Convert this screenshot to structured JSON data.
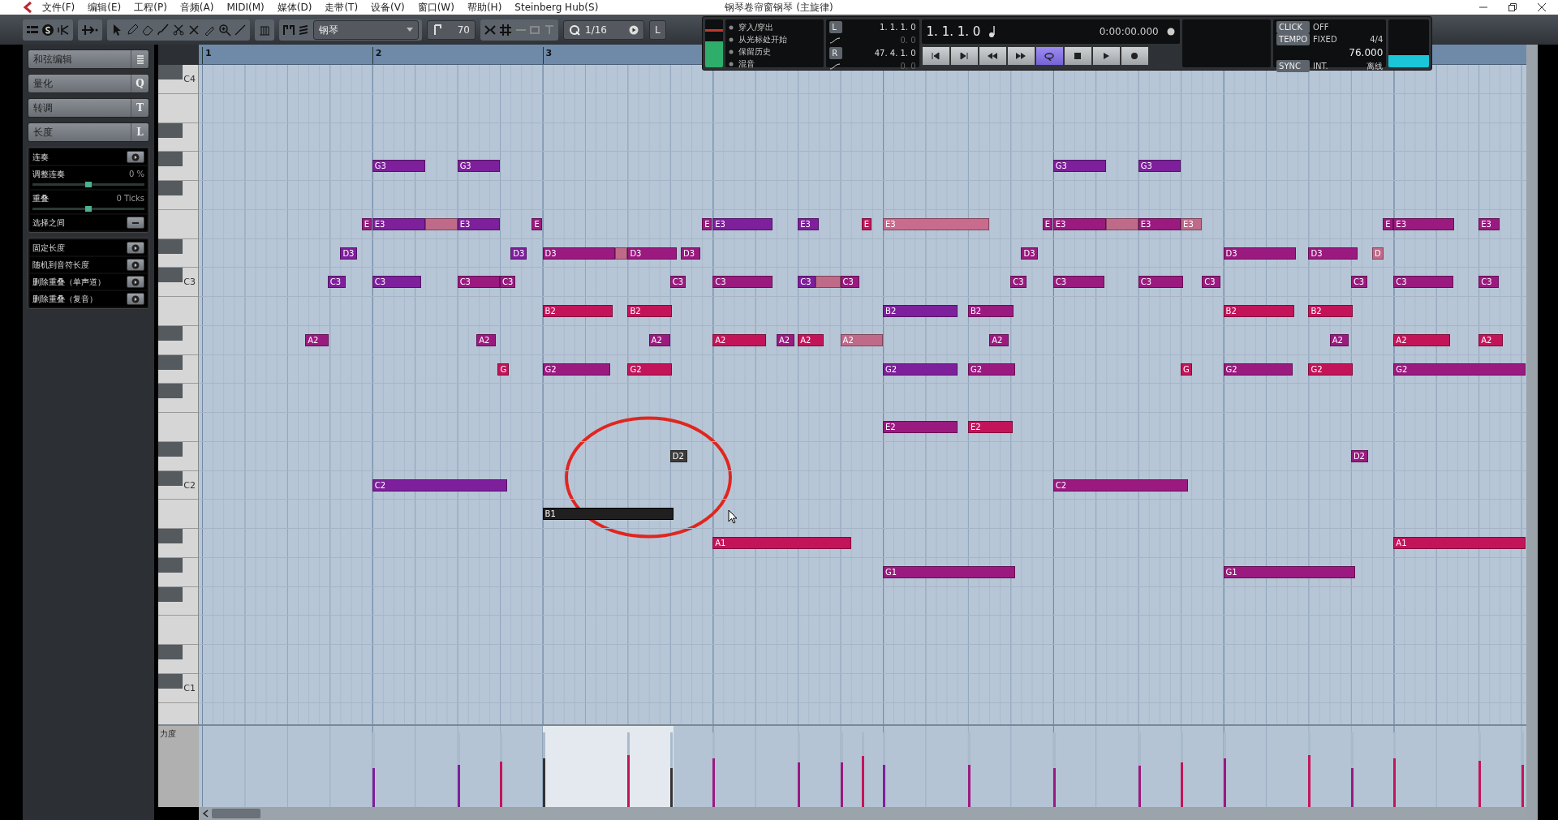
{
  "window": {
    "title": "钢琴卷帘窗钢琴 (主旋律)"
  },
  "menu": [
    "文件(F)",
    "编辑(E)",
    "工程(P)",
    "音频(A)",
    "MIDI(M)",
    "媒体(D)",
    "走带(T)",
    "设备(V)",
    "窗口(W)",
    "帮助(H)",
    "Steinberg Hub(S)"
  ],
  "toolbar": {
    "instrument": "钢琴",
    "velocity": "70",
    "quantize": "1/16",
    "extra_button": "L"
  },
  "transport": {
    "options": [
      "穿入/穿出",
      "从光标处开始",
      "保留历史",
      "混音"
    ],
    "left_label": "L",
    "left_locator": "1. 1. 1. 0",
    "left_offset": "0. 0",
    "right_label": "R",
    "right_locator": "47. 4. 1. 0",
    "right_offset": "0. 0",
    "position": "1. 1. 1. 0",
    "time": "0:00:00.000",
    "buttons": [
      {
        "kind": "to-start",
        "on": false
      },
      {
        "kind": "to-end",
        "on": false
      },
      {
        "kind": "rewind",
        "on": false
      },
      {
        "kind": "forward",
        "on": false
      },
      {
        "kind": "cycle",
        "on": true
      },
      {
        "kind": "stop",
        "on": false
      },
      {
        "kind": "play",
        "on": false
      },
      {
        "kind": "record",
        "on": false
      }
    ],
    "click_label": "CLICK",
    "click_value": "OFF",
    "tempo_label": "TEMPO",
    "tempo_mode": "FIXED",
    "signature": "4/4",
    "tempo": "76.000",
    "sync_label": "SYNC",
    "sync_value": "INT.",
    "sync_state": "离线"
  },
  "inspector": {
    "sections": [
      {
        "title": "和弦编辑"
      },
      {
        "title": "量化",
        "shortcut": "Q"
      },
      {
        "title": "转调",
        "shortcut": "T"
      },
      {
        "title": "长度",
        "shortcut": "L"
      }
    ],
    "legato_tools": [
      {
        "kind": "action",
        "label": "连奏"
      },
      {
        "kind": "slider",
        "label": "调整连奏",
        "value": "0 %",
        "level": 0.5
      },
      {
        "kind": "slider",
        "label": "重叠",
        "value": "0 Ticks",
        "level": 0.5
      },
      {
        "kind": "toggle",
        "label": "选择之间"
      }
    ],
    "length_tools": [
      {
        "kind": "action",
        "label": "固定长度"
      },
      {
        "kind": "action",
        "label": "随机到音符长度"
      },
      {
        "kind": "action",
        "label": "删除重叠（单声道）"
      },
      {
        "kind": "action",
        "label": "删除重叠（复音）"
      }
    ]
  },
  "ruler": [
    "1",
    "2",
    "3"
  ],
  "keyboard": {
    "keys": [
      {
        "label": "C4",
        "black_above": true
      },
      {
        "black_above": false
      },
      {
        "black_above": true
      },
      {
        "black_above": true,
        "notes": [
          {
            "label": "G3",
            "color": "#7e1f9c",
            "selected": false
          },
          {
            "label": "G3",
            "color": "#7e1f9c",
            "selected": false
          },
          {
            "label": "G3",
            "color": "#7e1f9c",
            "selected": false
          },
          {
            "label": "G3",
            "color": "#7e1f9c",
            "selected": false
          }
        ]
      },
      {
        "black_above": true
      },
      {
        "black_above": false,
        "notes": [
          {
            "label": "E",
            "color": "#9a1a80",
            "selected": false
          },
          {
            "label": "E3",
            "color": "#7e1f9c",
            "selected": false
          },
          {
            "color": "#c06a8a",
            "selected": false
          },
          {
            "label": "E3",
            "color": "#7e1f9c",
            "selected": false
          },
          {
            "label": "E",
            "color": "#9a1a80",
            "selected": false
          },
          {
            "label": "E",
            "color": "#9a1a80",
            "selected": false
          },
          {
            "label": "E3",
            "color": "#7e1f9c",
            "selected": false
          },
          {
            "label": "E3",
            "color": "#7e1f9c",
            "selected": false
          },
          {
            "label": "E",
            "color": "#c3145a",
            "selected": false
          },
          {
            "label": "E3",
            "color": "#c96b8c",
            "selected": false
          },
          {
            "label": "E",
            "color": "#9a1a80",
            "selected": false
          },
          {
            "label": "E3",
            "color": "#9a1a80",
            "selected": false
          },
          {
            "color": "#c06a8a",
            "selected": false
          },
          {
            "label": "E3",
            "color": "#9a1a80",
            "selected": false
          },
          {
            "label": "E3",
            "color": "#c06a8a",
            "selected": false
          },
          {
            "label": "E",
            "color": "#9a1a80",
            "selected": false
          },
          {
            "label": "E3",
            "color": "#9a1a80",
            "selected": false
          },
          {
            "label": "E3",
            "color": "#9a1a80",
            "selected": false
          }
        ]
      },
      {
        "black_above": true,
        "notes": [
          {
            "label": "D3",
            "color": "#7e1f9c",
            "selected": false
          },
          {
            "label": "D3",
            "color": "#7e1f9c",
            "selected": false
          },
          {
            "label": "D3",
            "color": "#9a1a80",
            "selected": false
          },
          {
            "color": "#c06a8a",
            "selected": false
          },
          {
            "label": "D3",
            "color": "#9a1a80",
            "selected": false
          },
          {
            "label": "D3",
            "color": "#9a1a80",
            "selected": false
          },
          {
            "label": "D3",
            "color": "#9a1a80",
            "selected": false
          },
          {
            "label": "D3",
            "color": "#9a1a80",
            "selected": false
          },
          {
            "label": "D3",
            "color": "#9a1a80",
            "selected": false
          },
          {
            "label": "D",
            "color": "#c06a8a",
            "selected": false
          }
        ]
      },
      {
        "label": "C3",
        "black_above": true,
        "notes": [
          {
            "label": "C3",
            "color": "#7e1f9c",
            "selected": false
          },
          {
            "label": "C3",
            "color": "#7e1f9c",
            "selected": false
          },
          {
            "label": "C3",
            "color": "#9a1a80",
            "selected": false
          },
          {
            "label": "C3",
            "color": "#9a1a80",
            "selected": false
          },
          {
            "label": "C3",
            "color": "#9a1a80",
            "selected": false
          },
          {
            "label": "C3",
            "color": "#9a1a80",
            "selected": false
          },
          {
            "label": "C3",
            "color": "#7e1f9c",
            "selected": false
          },
          {
            "color": "#c06a8a",
            "selected": false
          },
          {
            "label": "C3",
            "color": "#9a1a80",
            "selected": false
          },
          {
            "label": "C3",
            "color": "#9a1a80",
            "selected": false
          },
          {
            "label": "C3",
            "color": "#9a1a80",
            "selected": false
          },
          {
            "label": "C3",
            "color": "#9a1a80",
            "selected": false
          },
          {
            "label": "C3",
            "color": "#9a1a80",
            "selected": false
          },
          {
            "label": "C3",
            "color": "#9a1a80",
            "selected": false
          },
          {
            "label": "C3",
            "color": "#9a1a80",
            "selected": false
          },
          {
            "label": "C3",
            "color": "#9a1a80",
            "selected": false
          }
        ]
      },
      {
        "black_above": false,
        "notes": [
          {
            "label": "B2",
            "color": "#c3145a",
            "selected": false
          },
          {
            "label": "B2",
            "color": "#c3145a",
            "selected": false
          },
          {
            "label": "B2",
            "color": "#7e1f9c",
            "selected": false
          },
          {
            "label": "B2",
            "color": "#9a1a80",
            "selected": false
          },
          {
            "label": "B2",
            "color": "#c3145a",
            "selected": false
          },
          {
            "label": "B2",
            "color": "#c3145a",
            "selected": false
          }
        ]
      },
      {
        "black_above": true,
        "notes": [
          {
            "label": "A2",
            "color": "#9a1a80",
            "selected": false
          },
          {
            "label": "A2",
            "color": "#9a1a80",
            "selected": false
          },
          {
            "label": "A2",
            "color": "#9a1a80",
            "selected": false
          },
          {
            "label": "A2",
            "color": "#c3145a",
            "selected": false
          },
          {
            "label": "A2",
            "color": "#9a1a80",
            "selected": false
          },
          {
            "label": "A2",
            "color": "#c3145a",
            "selected": false
          },
          {
            "label": "A2",
            "color": "#c06a8a",
            "selected": false
          },
          {
            "label": "A2",
            "color": "#9a1a80",
            "selected": false
          },
          {
            "label": "A2",
            "color": "#9a1a80",
            "selected": false
          },
          {
            "label": "A2",
            "color": "#c3145a",
            "selected": false
          },
          {
            "label": "A2",
            "color": "#c3145a",
            "selected": false
          }
        ]
      },
      {
        "black_above": true,
        "notes": [
          {
            "label": "G",
            "color": "#c3145a",
            "selected": false
          },
          {
            "label": "G2",
            "color": "#9a1a80",
            "selected": false
          },
          {
            "label": "G2",
            "color": "#c3145a",
            "selected": false
          },
          {
            "label": "G2",
            "color": "#7e1f9c",
            "selected": false
          },
          {
            "label": "G2",
            "color": "#9a1a80",
            "selected": false
          },
          {
            "label": "G",
            "color": "#c3145a",
            "selected": false
          },
          {
            "label": "G2",
            "color": "#9a1a80",
            "selected": false
          },
          {
            "label": "G2",
            "color": "#c3145a",
            "selected": false
          },
          {
            "label": "G2",
            "color": "#9a1a80",
            "selected": false
          }
        ]
      },
      {
        "black_above": true
      },
      {
        "black_above": false,
        "notes": [
          {
            "label": "E2",
            "color": "#9a1a80",
            "selected": false
          },
          {
            "label": "E2",
            "color": "#c3145a",
            "selected": false
          }
        ]
      },
      {
        "black_above": true,
        "notes": [
          {
            "label": "D2",
            "color": "#3c3c3c",
            "selected": false
          },
          {
            "label": "D2",
            "color": "#9a1a80",
            "selected": false
          }
        ]
      },
      {
        "label": "C2",
        "black_above": true,
        "notes": [
          {
            "label": "C2",
            "color": "#7e1f9c",
            "selected": false
          },
          {
            "label": "C2",
            "color": "#9a1a80",
            "selected": false
          }
        ]
      },
      {
        "black_above": false,
        "notes": [
          {
            "label": "B1",
            "selected": true
          }
        ]
      },
      {
        "black_above": true,
        "notes": [
          {
            "label": "A1",
            "color": "#c3145a",
            "selected": false
          },
          {
            "label": "A1",
            "color": "#c3145a",
            "selected": false
          }
        ]
      },
      {
        "black_above": true,
        "notes": [
          {
            "label": "G1",
            "color": "#9a1a80",
            "selected": false
          },
          {
            "label": "G1",
            "color": "#9a1a80",
            "selected": false
          }
        ]
      },
      {
        "black_above": true
      },
      {
        "black_above": false
      },
      {
        "black_above": true
      },
      {
        "label": "C1",
        "black_above": true
      }
    ]
  },
  "velocity_lane": {
    "label": "力度",
    "bars": [
      {
        "level": 0.52,
        "color": "#7e1f9c"
      },
      {
        "level": 0.57,
        "color": "#7e1f9c"
      },
      {
        "level": 0.61,
        "color": "#c3145a"
      },
      {
        "level": 0.65,
        "color": "#333333"
      },
      {
        "level": 0.7,
        "color": "#c3145a"
      },
      {
        "level": 0.52,
        "color": "#333333"
      },
      {
        "level": 0.65,
        "color": "#9a1a80"
      },
      {
        "level": 0.6,
        "color": "#9a1a80"
      },
      {
        "level": 0.6,
        "color": "#9a1a80"
      },
      {
        "level": 0.68,
        "color": "#c3145a"
      },
      {
        "level": 0.57,
        "color": "#7e1f9c"
      },
      {
        "level": 0.57,
        "color": "#9a1a80"
      },
      {
        "level": 0.52,
        "color": "#9a1a80"
      },
      {
        "level": 0.55,
        "color": "#9a1a80"
      },
      {
        "level": 0.6,
        "color": "#c3145a"
      },
      {
        "level": 0.65,
        "color": "#9a1a80"
      },
      {
        "level": 0.7,
        "color": "#c3145a"
      },
      {
        "level": 0.52,
        "color": "#9a1a80"
      },
      {
        "level": 0.65,
        "color": "#c3145a"
      },
      {
        "level": 0.62,
        "color": "#c3145a"
      },
      {
        "level": 0.57,
        "color": "#c3145a"
      }
    ]
  }
}
